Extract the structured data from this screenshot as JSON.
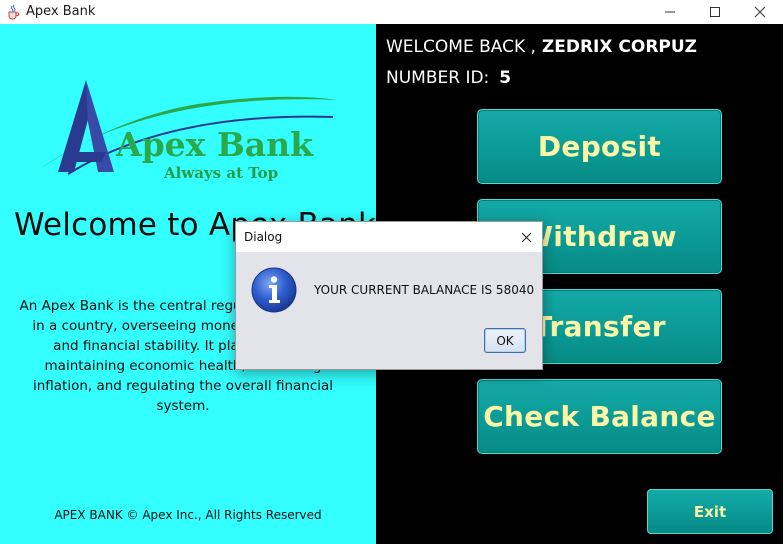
{
  "window": {
    "title": "Apex Bank",
    "icon": "java-cup-icon"
  },
  "left": {
    "logo": {
      "brand": "Apex Bank",
      "tagline": "Always at Top"
    },
    "welcome_title": "Welcome to Apex Bank!",
    "description": "An Apex Bank is the central regulatory authority in a country, overseeing monetary issuance, and financial stability. It plays a role in maintaining economic health, controlling inflation, and regulating the overall financial system.",
    "footer": "APEX BANK © Apex Inc., All Rights Reserved"
  },
  "user": {
    "welcome_label": "WELCOME BACK ,",
    "name": "ZEDRIX CORPUZ",
    "number_id_label": "NUMBER ID:",
    "number_id": "5"
  },
  "menu": {
    "deposit": "Deposit",
    "withdraw": "Withdraw",
    "transfer": "Transfer",
    "check_balance": "Check Balance",
    "exit": "Exit"
  },
  "dialog": {
    "title": "Dialog",
    "message": "YOUR CURRENT BALANACE IS 58040",
    "ok_label": "OK",
    "icon": "info-icon"
  },
  "colors": {
    "left_bg": "#33ffff",
    "right_bg": "#000000",
    "button_bg": "#0b9a96",
    "button_text": "#fbf7a6",
    "logo_blue": "#2a3b8f",
    "logo_green": "#2aa84a"
  }
}
